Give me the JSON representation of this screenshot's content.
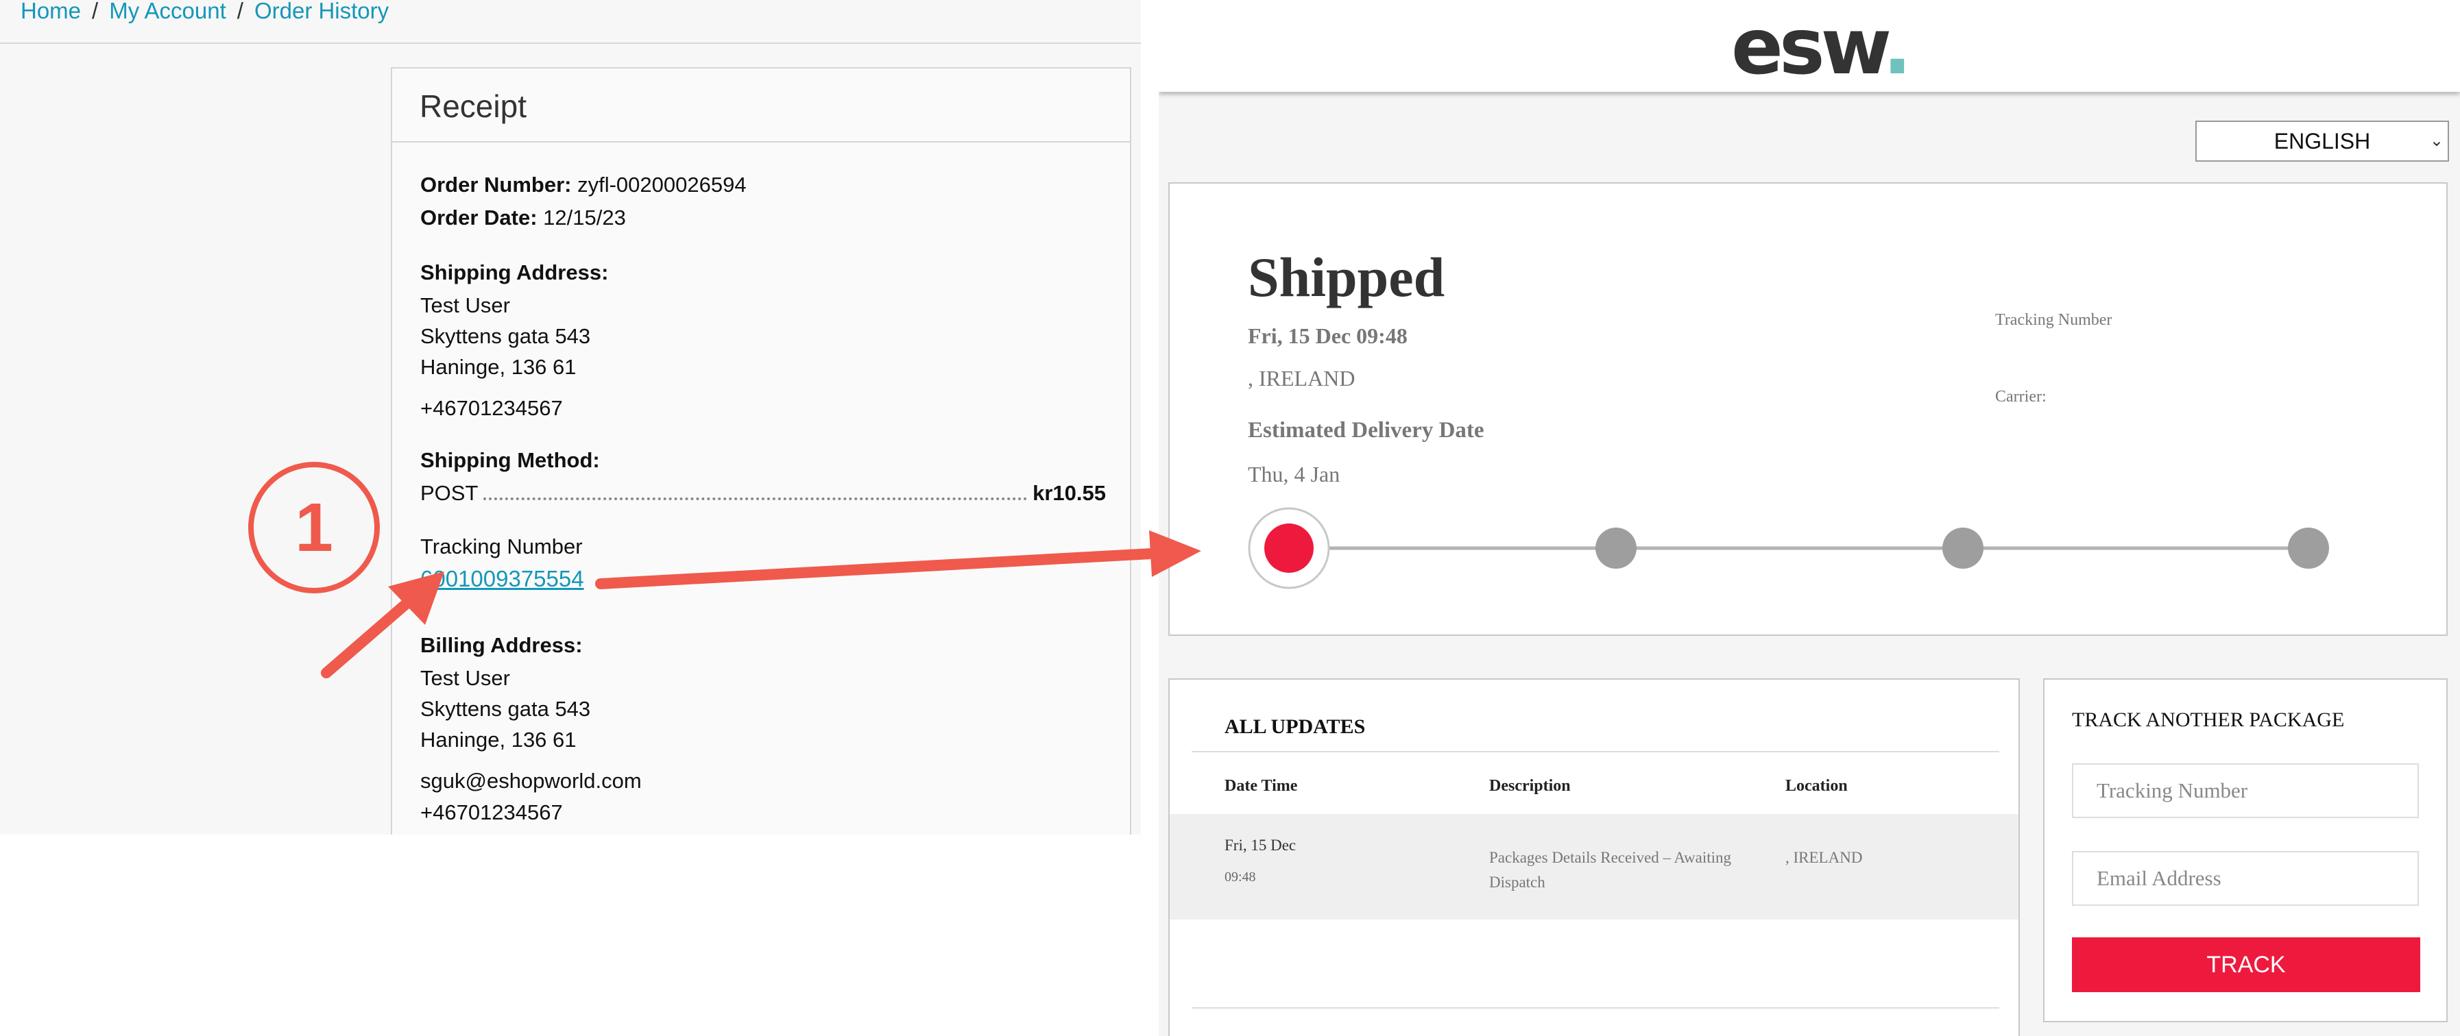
{
  "breadcrumb": {
    "home": "Home",
    "sep": "/",
    "account": "My Account",
    "history": "Order History"
  },
  "receipt": {
    "title": "Receipt",
    "order_number_label": "Order Number:",
    "order_number": "zyfl-00200026594",
    "order_date_label": "Order Date:",
    "order_date": "12/15/23",
    "shipping_address_label": "Shipping Address:",
    "shipping_address": [
      "Test User",
      "Skyttens gata 543",
      "Haninge, 136 61"
    ],
    "shipping_phone": "+46701234567",
    "shipping_method_label": "Shipping Method:",
    "shipping_method": "POST",
    "shipping_price": "kr10.55",
    "tracking_number_label": "Tracking Number",
    "tracking_number": "6001009375554",
    "billing_address_label": "Billing Address:",
    "billing_address": [
      "Test User",
      "Skyttens gata 543",
      "Haninge, 136 61"
    ],
    "billing_email": "sguk@eshopworld.com",
    "billing_phone": "+46701234567"
  },
  "annotation": {
    "step_number": "1",
    "color": "#ef5a4c"
  },
  "esw": {
    "logo_text": "esw",
    "logo_dot": ".",
    "language": "ENGLISH",
    "status": {
      "title": "Shipped",
      "date": "Fri, 15 Dec 09:48",
      "location": ", IRELAND",
      "estimated_label": "Estimated Delivery Date",
      "estimated_value": "Thu, 4 Jan",
      "tracking_number_label": "Tracking Number",
      "carrier_label": "Carrier:",
      "progress_steps": 4,
      "progress_active_step": 1,
      "active_color": "#ee1a3e",
      "inactive_color": "#9e9e9e"
    },
    "updates": {
      "title": "ALL UPDATES",
      "columns": [
        "Date Time",
        "Description",
        "Location"
      ],
      "rows": [
        {
          "date": "Fri, 15 Dec",
          "time": "09:48",
          "description_1": "Packages Details Received – Awaiting",
          "description_2": "Dispatch",
          "location": ", IRELAND"
        }
      ]
    },
    "track_another": {
      "title": "TRACK ANOTHER PACKAGE",
      "tracking_placeholder": "Tracking Number",
      "email_placeholder": "Email Address",
      "button": "TRACK"
    }
  }
}
